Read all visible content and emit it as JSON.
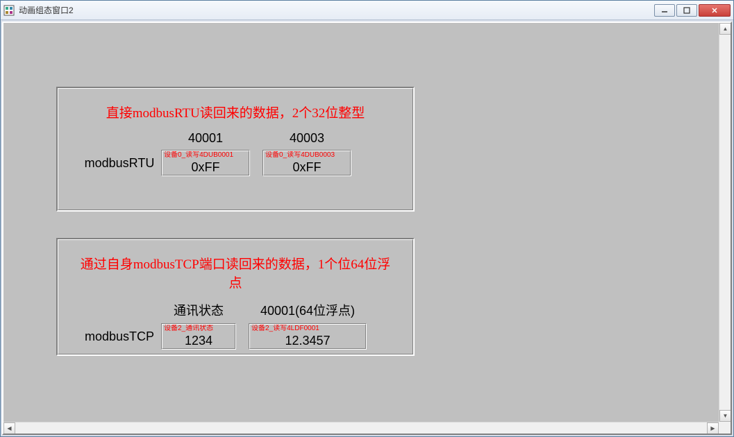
{
  "window": {
    "title": "动画组态窗口2"
  },
  "panel1": {
    "title": "直接modbusRTU读回来的数据，2个32位整型",
    "row_label": "modbusRTU",
    "headers": [
      "40001",
      "40003"
    ],
    "fields": [
      {
        "tag": "设备0_读写4DUB0001",
        "value": "0xFF"
      },
      {
        "tag": "设备0_读写4DUB0003",
        "value": "0xFF"
      }
    ]
  },
  "panel2": {
    "title": "通过自身modbusTCP端口读回来的数据，1个位64位浮点",
    "row_label": "modbusTCP",
    "headers": [
      "通讯状态",
      "40001(64位浮点)"
    ],
    "fields": [
      {
        "tag": "设备2_通讯状态",
        "value": "1234"
      },
      {
        "tag": "设备2_读写4LDF0001",
        "value": "12.3457"
      }
    ]
  }
}
